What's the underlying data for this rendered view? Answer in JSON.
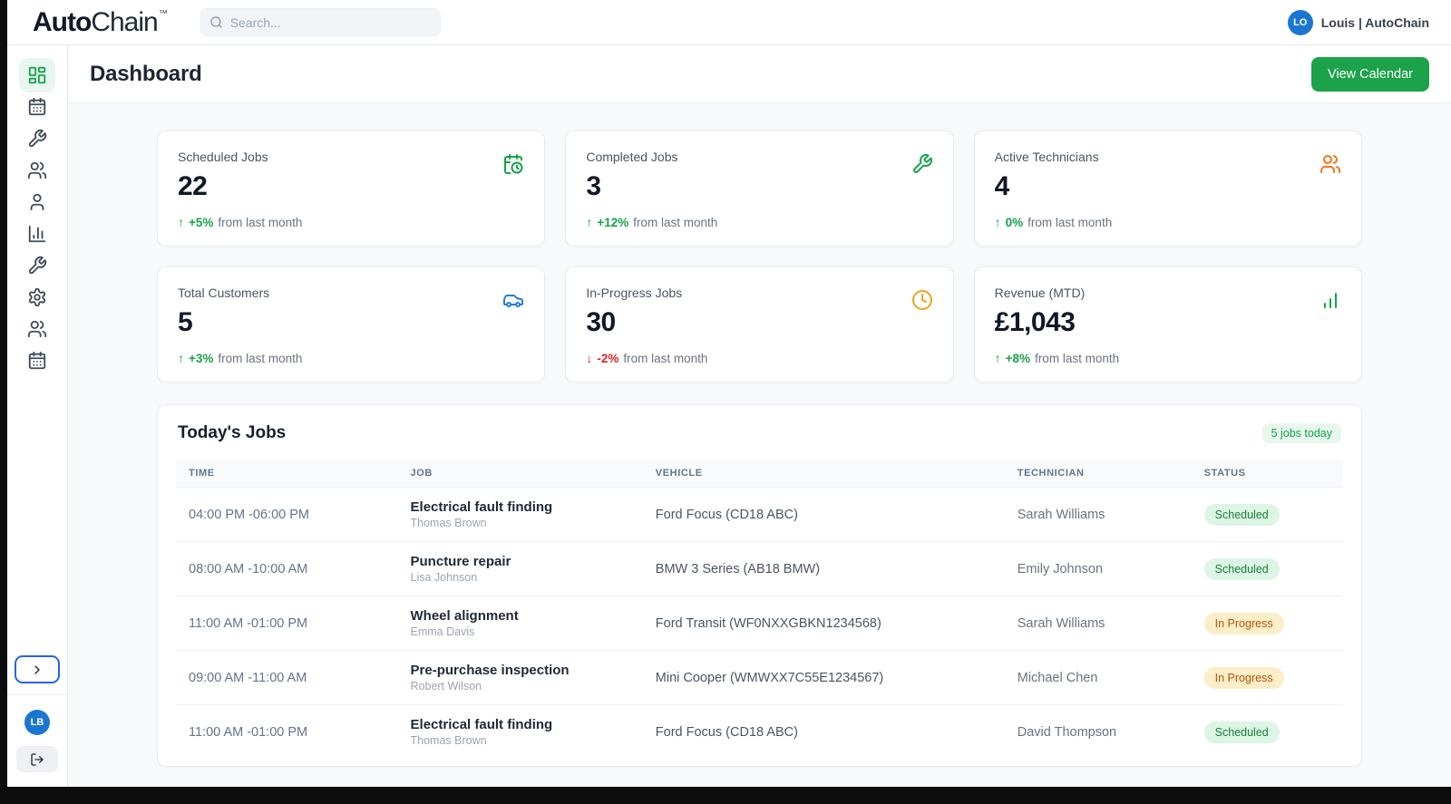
{
  "topbar": {
    "logo_bold": "Auto",
    "logo_light": "Chain",
    "logo_tm": "™",
    "search_placeholder": "Search...",
    "user_initials": "LO",
    "user_name": "Louis | AutoChain"
  },
  "sidebar": {
    "items": [
      {
        "name": "dashboard",
        "icon": "layout-grid-icon",
        "active": "active"
      },
      {
        "name": "calendar",
        "icon": "calendar-icon",
        "active": ""
      },
      {
        "name": "jobs",
        "icon": "wrench-icon",
        "active": ""
      },
      {
        "name": "technicians",
        "icon": "users-icon",
        "active": ""
      },
      {
        "name": "customers",
        "icon": "user-icon",
        "active": ""
      },
      {
        "name": "reports",
        "icon": "bar-chart-axis-icon",
        "active": ""
      },
      {
        "name": "tools",
        "icon": "wrench-icon",
        "active": ""
      },
      {
        "name": "settings",
        "icon": "gear-icon",
        "active": ""
      },
      {
        "name": "team",
        "icon": "users-icon",
        "active": ""
      },
      {
        "name": "schedule",
        "icon": "calendar-icon",
        "active": ""
      }
    ],
    "avatar_initials": "LB"
  },
  "header": {
    "title": "Dashboard",
    "calendar_button": "View Calendar"
  },
  "stats": {
    "cards": [
      {
        "label": "Scheduled Jobs",
        "value": "22",
        "icon": "calendar-clock-icon",
        "icon_color": "green",
        "trend": {
          "dir": "up",
          "arrow": "↑",
          "value": "+5%",
          "caption": "from last month"
        }
      },
      {
        "label": "Completed Jobs",
        "value": "3",
        "icon": "wrench-icon",
        "icon_color": "green",
        "trend": {
          "dir": "up",
          "arrow": "↑",
          "value": "+12%",
          "caption": "from last month"
        }
      },
      {
        "label": "Active Technicians",
        "value": "4",
        "icon": "users-icon",
        "icon_color": "orange",
        "trend": {
          "dir": "up",
          "arrow": "↑",
          "value": "0%",
          "caption": "from last month"
        }
      },
      {
        "label": "Total Customers",
        "value": "5",
        "icon": "car-icon",
        "icon_color": "blue",
        "trend": {
          "dir": "up",
          "arrow": "↑",
          "value": "+3%",
          "caption": "from last month"
        }
      },
      {
        "label": "In-Progress Jobs",
        "value": "30",
        "icon": "clock-icon",
        "icon_color": "amber",
        "trend": {
          "dir": "down",
          "arrow": "↓",
          "value": "-2%",
          "caption": "from last month"
        }
      },
      {
        "label": "Revenue (MTD)",
        "value": "£1,043",
        "icon": "bar-chart-icon",
        "icon_color": "green",
        "trend": {
          "dir": "up",
          "arrow": "↑",
          "value": "+8%",
          "caption": "from last month"
        }
      }
    ]
  },
  "jobs": {
    "title": "Today's Jobs",
    "count_badge": "5 jobs today",
    "columns": {
      "time": "Time",
      "job": "Job",
      "vehicle": "Vehicle",
      "technician": "Technician",
      "status": "Status"
    },
    "rows": [
      {
        "time": "04:00 PM -06:00 PM",
        "job": "Electrical fault finding",
        "customer": "Thomas Brown",
        "vehicle": "Ford Focus (CD18 ABC)",
        "technician": "Sarah Williams",
        "status": "Scheduled",
        "variant": "scheduled"
      },
      {
        "time": "08:00 AM -10:00 AM",
        "job": "Puncture repair",
        "customer": "Lisa Johnson",
        "vehicle": "BMW 3 Series (AB18 BMW)",
        "technician": "Emily Johnson",
        "status": "Scheduled",
        "variant": "scheduled"
      },
      {
        "time": "11:00 AM -01:00 PM",
        "job": "Wheel alignment",
        "customer": "Emma Davis",
        "vehicle": "Ford Transit (WF0NXXGBKN1234568)",
        "technician": "Sarah Williams",
        "status": "In Progress",
        "variant": "in-progress"
      },
      {
        "time": "09:00 AM -11:00 AM",
        "job": "Pre-purchase inspection",
        "customer": "Robert Wilson",
        "vehicle": "Mini Cooper (WMWXX7C55E1234567)",
        "technician": "Michael Chen",
        "status": "In Progress",
        "variant": "in-progress"
      },
      {
        "time": "11:00 AM -01:00 PM",
        "job": "Electrical fault finding",
        "customer": "Thomas Brown",
        "vehicle": "Ford Focus (CD18 ABC)",
        "technician": "David Thompson",
        "status": "Scheduled",
        "variant": "scheduled"
      }
    ]
  },
  "colors": {
    "accent_green": "#16a34a",
    "avatar_blue": "#1b76d2",
    "status_scheduled_bg": "#dcf5e4",
    "status_scheduled_text": "#15803d",
    "status_inprogress_bg": "#fbeec8",
    "status_inprogress_text": "#b45309",
    "trend_down_red": "#dc2626",
    "icon_orange": "#f97316",
    "icon_amber": "#eaa620",
    "icon_blue": "#2480d6"
  }
}
